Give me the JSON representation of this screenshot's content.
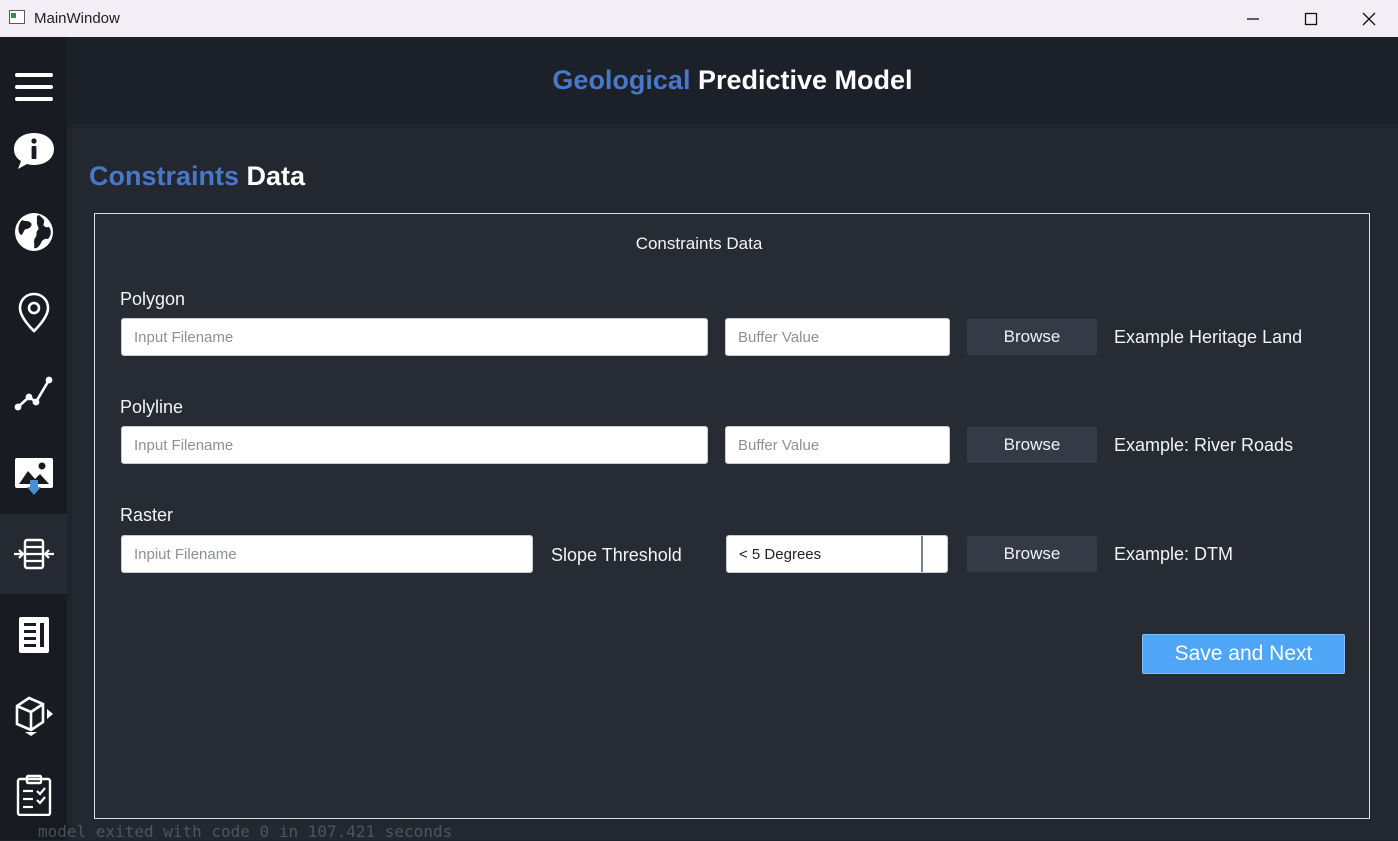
{
  "window": {
    "title": "MainWindow"
  },
  "header": {
    "title_accent": "Geological",
    "title_rest": "Predictive Model"
  },
  "section": {
    "title_accent": "Constraints",
    "title_rest": "Data"
  },
  "panel": {
    "title": "Constraints Data"
  },
  "polygon": {
    "label": "Polygon",
    "filename_placeholder": "Input Filename",
    "buffer_placeholder": "Buffer Value",
    "browse_label": "Browse",
    "example": "Example Heritage Land"
  },
  "polyline": {
    "label": "Polyline",
    "filename_placeholder": "Input Filename",
    "buffer_placeholder": "Buffer Value",
    "browse_label": "Browse",
    "example": "Example: River Roads"
  },
  "raster": {
    "label": "Raster",
    "filename_placeholder": "Inpiut Filename",
    "slope_label": "Slope Threshold",
    "slope_value": "< 5 Degrees",
    "browse_label": "Browse",
    "example": "Example: DTM"
  },
  "actions": {
    "save_next_label": "Save and Next"
  },
  "background_text": "model exited with code 0 in 107.421 seconds",
  "sidebar": {
    "items": [
      {
        "icon": "menu-icon"
      },
      {
        "icon": "info-icon"
      },
      {
        "icon": "globe-icon"
      },
      {
        "icon": "location-pin-icon"
      },
      {
        "icon": "polyline-icon"
      },
      {
        "icon": "image-download-icon"
      },
      {
        "icon": "layers-compress-icon",
        "active": true
      },
      {
        "icon": "report-icon"
      },
      {
        "icon": "cube-icon"
      },
      {
        "icon": "clipboard-check-icon"
      }
    ]
  },
  "colors": {
    "accent": "#4a78c9",
    "primary_button": "#4fa6f7",
    "sidebar_bg": "#181b21"
  }
}
